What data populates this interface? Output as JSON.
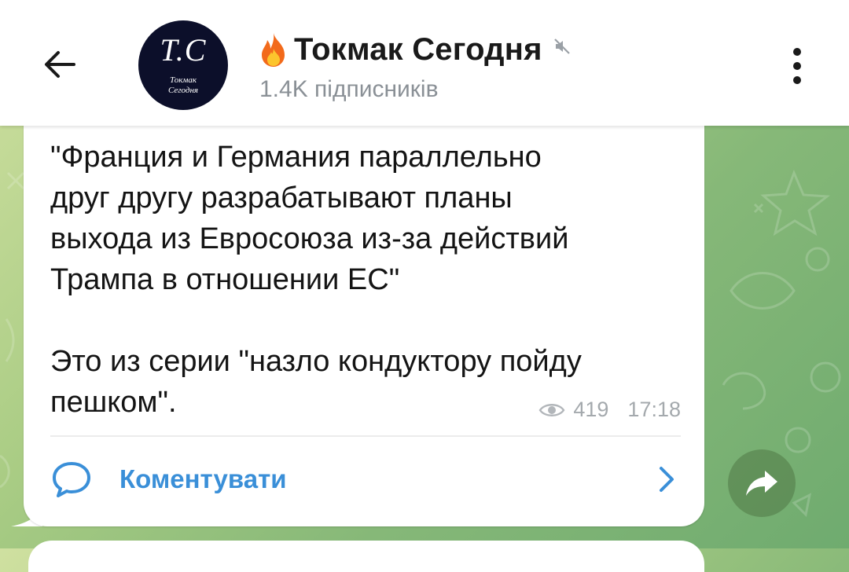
{
  "header": {
    "channel_title": "Токмак Сегодня",
    "subscribers": "1.4K підписників",
    "avatar_monogram": "T.C",
    "avatar_caption_line1": "Токмак",
    "avatar_caption_line2": "Сегодня",
    "icons": [
      "back-arrow-icon",
      "fire-icon",
      "muted-speaker-icon",
      "more-vertical-icon"
    ]
  },
  "message": {
    "text": "\"Франция и Германия параллельно\nдруг другу разрабатывают планы\nвыхода из Евросоюза из-за действий\nТрампа в отношении ЕС\"\n\nЭто из серии \"назло кондуктору пойду\nпешком\".",
    "views": "419",
    "time": "17:18",
    "comment_label": "Коментувати"
  },
  "colors": {
    "accent": "#3a8fd8",
    "avatar_bg": "#0c0f2a",
    "meta_gray": "#a4a9ad",
    "background_green": "#86b878"
  }
}
